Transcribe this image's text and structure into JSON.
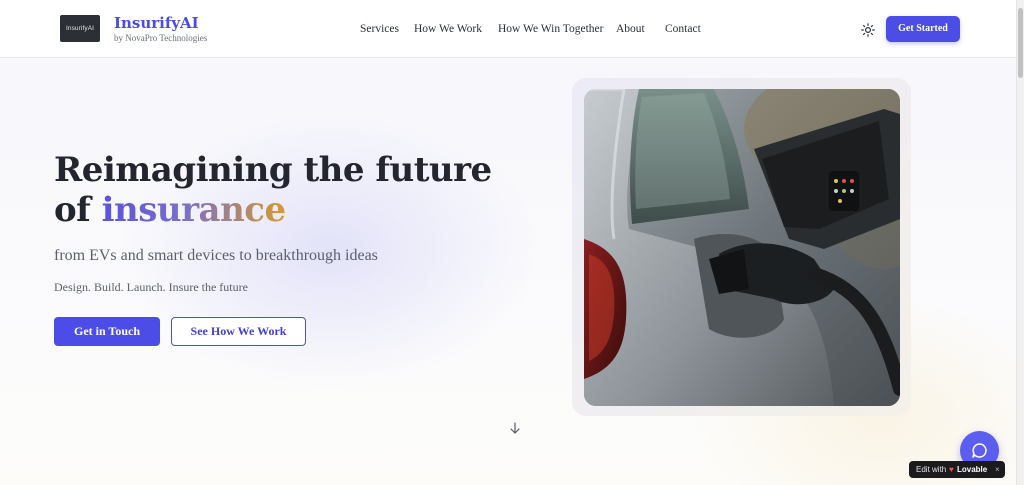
{
  "header": {
    "logo_text": "InsurifyAI",
    "brand_title": "InsurifyAI",
    "brand_subtitle": "by NovaPro Technologies",
    "nav": [
      {
        "label": "Services"
      },
      {
        "label": "How We Work"
      },
      {
        "label": "How We Win Together"
      },
      {
        "label": "About"
      },
      {
        "label": "Contact"
      }
    ],
    "theme_toggle_icon": "sun-icon",
    "cta_label": "Get Started"
  },
  "hero": {
    "headline_line1": "Reimagining the future",
    "headline_line2_prefix": "of ",
    "headline_line2_accent": "insurance",
    "subheadline": "from EVs and smart devices to breakthrough ideas",
    "tagline": "Design. Build. Launch. Insure the future",
    "primary_button": "Get in Touch",
    "secondary_button": "See How We Work",
    "scroll_icon": "arrow-down-icon",
    "image_icon": "ev-charging-photo"
  },
  "widgets": {
    "chat_icon": "chat-bubble-icon",
    "badge_edit": "Edit with",
    "badge_brand": "Lovable",
    "badge_close": "×"
  },
  "colors": {
    "accent": "#4b4de6",
    "brand_title": "#4a4ae8",
    "headline": "#23262f",
    "gradient_start": "#5b52e0",
    "gradient_end": "#d79c2c"
  }
}
